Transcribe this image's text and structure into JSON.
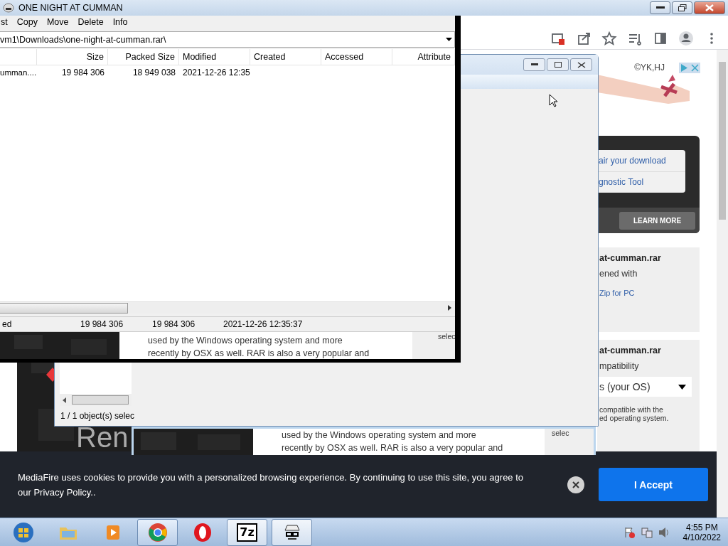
{
  "window": {
    "title": "ONE NIGHT AT CUMMAN"
  },
  "browser": {
    "toolbar_icons": [
      {
        "kind": "blocked-popup"
      },
      {
        "kind": "share"
      },
      {
        "kind": "star"
      },
      {
        "kind": "media"
      },
      {
        "kind": "side-panel"
      },
      {
        "kind": "profile"
      },
      {
        "kind": "more"
      }
    ],
    "ad": {
      "credit": "©YK,HJ"
    },
    "repair_card": {
      "links": [
        "air your download",
        "gnostic Tool"
      ],
      "button": "LEARN MORE"
    },
    "file_card": {
      "title": "at-cumman.rar",
      "subtitle": "ened with",
      "link": "Zip for PC"
    },
    "compat_card": {
      "title": "at-cumman.rar",
      "subtitle": "mpatibility",
      "select": "s (your OS)",
      "note_lines": [
        "compatible with the",
        "ed operating system."
      ]
    },
    "banner": {
      "text": "Ren"
    },
    "cookie": {
      "text": "MediaFire uses cookies to provide you with a personalized browsing experience. By continuing to use this site, you agree to our Privacy Policy..",
      "accept": "I Accept"
    }
  },
  "archiver": {
    "menu": [
      "st",
      "Copy",
      "Move",
      "Delete",
      "Info"
    ],
    "path": "vm1\\Downloads\\one-night-at-cumman.rar\\",
    "columns": [
      "Size",
      "Packed Size",
      "Modified",
      "Created",
      "Accessed",
      "Attribute"
    ],
    "rows": [
      {
        "name": "umman....",
        "cells": [
          "19 984 306",
          "18 949 038",
          "2021-12-26 12:35"
        ],
        "selected": false
      }
    ],
    "status": [
      "ed",
      "19 984 306",
      "19 984 306",
      "2021-12-26 12:35:37"
    ],
    "strip": {
      "lines": [
        "used by the Windows operating system and more",
        "recently by OSX as well. RAR is also a very popular and"
      ],
      "side": "selec"
    }
  },
  "dialog": {
    "status": "1 / 1 object(s) selec"
  },
  "back_strip": {
    "lines": [
      "used by the Windows operating system and more",
      "recently by OSX as well. RAR is also a very popular and"
    ],
    "side": "selec"
  },
  "taskbar": {
    "items": [
      {
        "kind": "start",
        "open": false,
        "selected": false
      },
      {
        "kind": "folder",
        "open": false,
        "selected": false
      },
      {
        "kind": "media",
        "open": false,
        "selected": false
      },
      {
        "kind": "chrome",
        "open": true,
        "selected": true
      },
      {
        "kind": "opera",
        "open": false,
        "selected": false
      },
      {
        "kind": "sevenzip",
        "label": "7z",
        "open": true,
        "selected": false
      },
      {
        "kind": "spy",
        "open": true,
        "selected": false
      }
    ],
    "tray": [
      {
        "kind": "flag"
      },
      {
        "kind": "network"
      },
      {
        "kind": "volume"
      }
    ],
    "time": "4:55 PM",
    "date": "4/10/2022"
  }
}
